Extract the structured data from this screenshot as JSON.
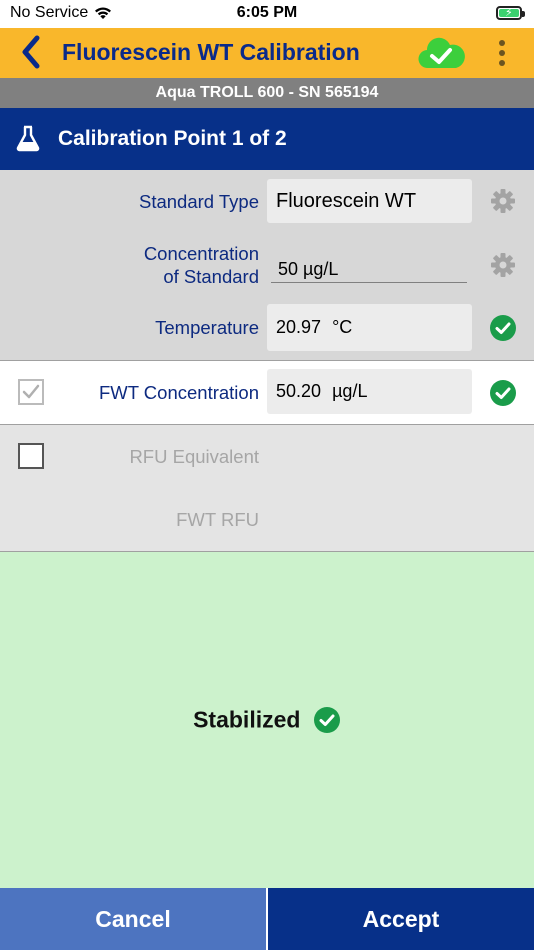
{
  "status_bar": {
    "carrier": "No Service",
    "time": "6:05 PM"
  },
  "nav": {
    "title": "Fluorescein WT Calibration",
    "back_icon": "chevron-left-icon",
    "cloud_icon": "cloud-check-icon",
    "more_icon": "more-vertical-icon",
    "accent_color": "#f9b72b",
    "title_color": "#0a2a8a"
  },
  "device": {
    "label": "Aqua TROLL 600 - SN 565194"
  },
  "section": {
    "title": "Calibration Point 1 of 2",
    "icon": "flask-icon",
    "background": "#073089"
  },
  "form": {
    "standard_type_label": "Standard Type",
    "standard_type_value": "Fluorescein WT",
    "concentration_label_line1": "Concentration",
    "concentration_label_line2": "of Standard",
    "concentration_value": "50 µg/L",
    "temperature_label": "Temperature",
    "temperature_value": "20.97",
    "temperature_unit": "°C"
  },
  "fwt": {
    "label": "FWT Concentration",
    "value": "50.20",
    "unit": "µg/L",
    "checked": true
  },
  "rfu": {
    "equivalent_label": "RFU Equivalent",
    "fwt_rfu_label": "FWT RFU",
    "checked": false
  },
  "stability": {
    "text": "Stabilized",
    "background": "#ccf2cc",
    "status_color": "#1a9c4a"
  },
  "buttons": {
    "cancel": "Cancel",
    "accept": "Accept"
  }
}
